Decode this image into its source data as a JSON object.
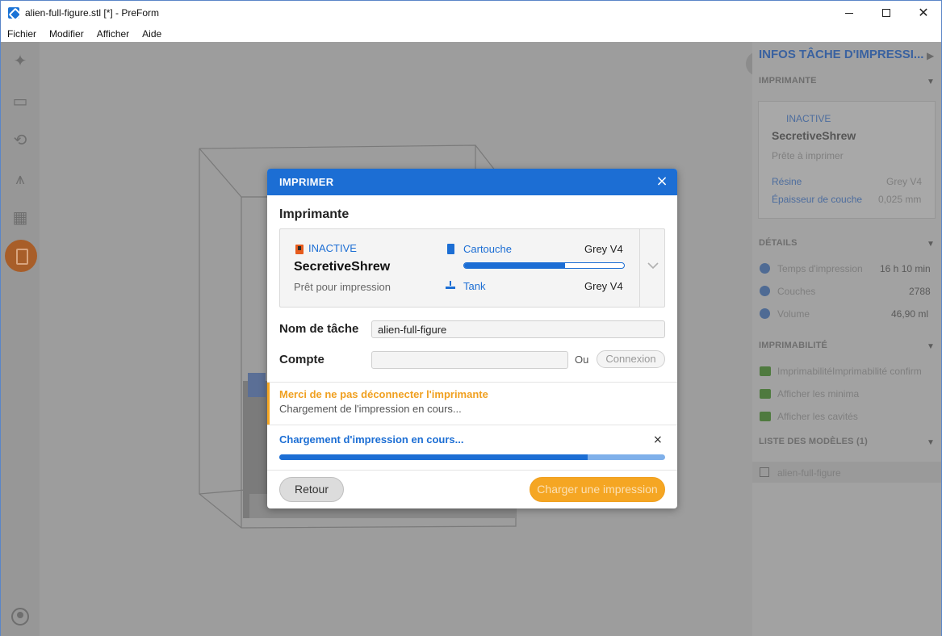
{
  "window": {
    "title": "alien-full-figure.stl [*] - PreForm"
  },
  "menu": [
    "Fichier",
    "Modifier",
    "Afficher",
    "Aide"
  ],
  "right_panel": {
    "title": "INFOS TÂCHE D'IMPRESSI...",
    "printer_section": "IMPRIMANTE",
    "printer_status": "INACTIVE",
    "printer_name": "SecretiveShrew",
    "printer_state": "Prête à imprimer",
    "resin_label": "Résine",
    "resin_value": "Grey V4",
    "layer_label": "Épaisseur de couche",
    "layer_value": "0,025 mm",
    "details_section": "DÉTAILS",
    "print_time_label": "Temps d'impression",
    "print_time_value": "16 h 10 min",
    "layers_label": "Couches",
    "layers_value": "2788",
    "volume_label": "Volume",
    "volume_value": "46,90 ml",
    "printability_section": "IMPRIMABILITÉ",
    "printability_items": [
      "ImprimabilitéImprimabilité confirm",
      "Afficher les minima",
      "Afficher les cavités"
    ],
    "models_section": "LISTE DES MODÈLES (1)",
    "model_name": "alien-full-figure"
  },
  "modal": {
    "title": "IMPRIMER",
    "close_icon": "×",
    "printer_heading": "Imprimante",
    "printer_status": "INACTIVE",
    "printer_name": "SecretiveShrew",
    "printer_state": "Prêt pour impression",
    "cartridge_label": "Cartouche",
    "cartridge_value": "Grey V4",
    "cartridge_level": 0.63,
    "tank_label": "Tank",
    "tank_value": "Grey V4",
    "job_name_label": "Nom de tâche",
    "job_name_value": "alien-full-figure",
    "account_label": "Compte",
    "account_value": "",
    "or_label": "Ou",
    "login_label": "Connexion",
    "warning_title": "Merci de ne pas déconnecter l'imprimante",
    "warning_text": "Chargement de l'impression en cours...",
    "progress_title": "Chargement d'impression en cours...",
    "progress_close": "×",
    "progress_value": 0.8,
    "back_label": "Retour",
    "upload_label": "Charger une impression"
  },
  "colors": {
    "accent": "#1c6ed4",
    "warning": "#f5a623"
  }
}
